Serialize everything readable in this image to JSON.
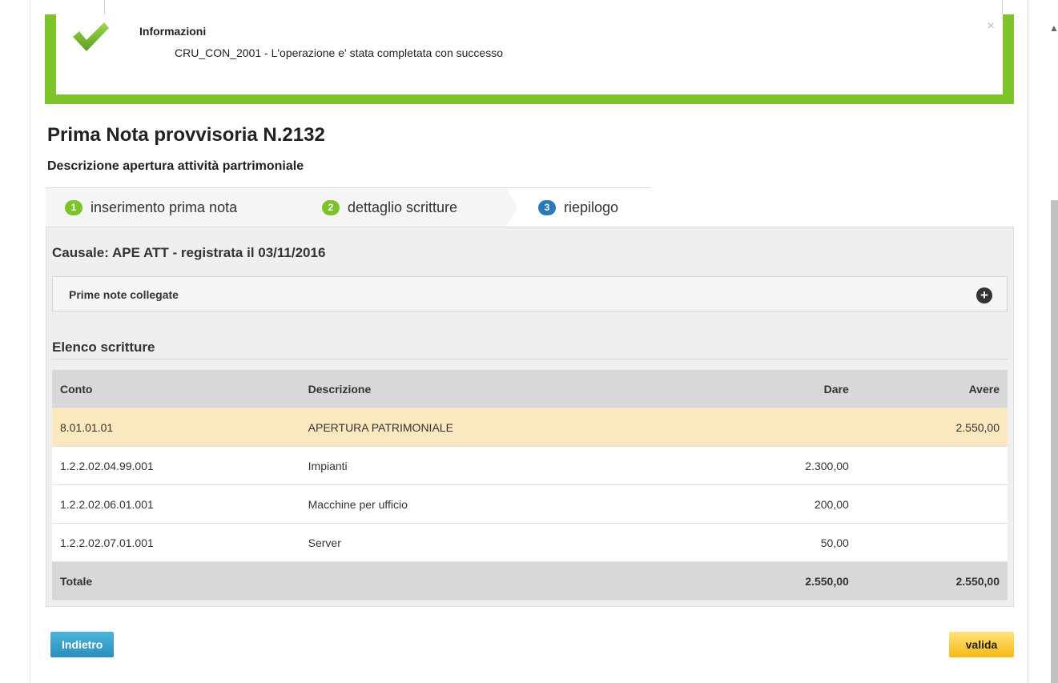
{
  "alert": {
    "title": "Informazioni",
    "message": "CRU_CON_2001 - L'operazione e' stata completata con successo",
    "close": "×",
    "color": "#7cc42a"
  },
  "page": {
    "title": "Prima Nota provvisoria N.2132",
    "subtitle": "Descrizione apertura attività partrimoniale"
  },
  "wizard": {
    "steps": [
      {
        "number": "1",
        "label": "inserimento prima nota",
        "state": "done"
      },
      {
        "number": "2",
        "label": "dettaglio scritture",
        "state": "done"
      },
      {
        "number": "3",
        "label": "riepilogo",
        "state": "active"
      }
    ]
  },
  "summary": {
    "causale": "Causale: APE ATT - registrata il 03/11/2016",
    "accordion_label": "Prime note collegate",
    "accordion_icon": "plus-icon",
    "section_title": "Elenco scritture"
  },
  "table": {
    "headers": {
      "conto": "Conto",
      "descrizione": "Descrizione",
      "dare": "Dare",
      "avere": "Avere"
    },
    "rows": [
      {
        "conto": "8.01.01.01",
        "descrizione": "APERTURA PATRIMONIALE",
        "dare": "",
        "avere": "2.550,00"
      },
      {
        "conto": "1.2.2.02.04.99.001",
        "descrizione": "Impianti",
        "dare": "2.300,00",
        "avere": ""
      },
      {
        "conto": "1.2.2.02.06.01.001",
        "descrizione": "Macchine per ufficio",
        "dare": "200,00",
        "avere": ""
      },
      {
        "conto": "1.2.2.02.07.01.001",
        "descrizione": "Server",
        "dare": "50,00",
        "avere": ""
      }
    ],
    "totals": {
      "label": "Totale",
      "dare": "2.550,00",
      "avere": "2.550,00"
    }
  },
  "buttons": {
    "back": "Indietro",
    "valida": "valida"
  }
}
